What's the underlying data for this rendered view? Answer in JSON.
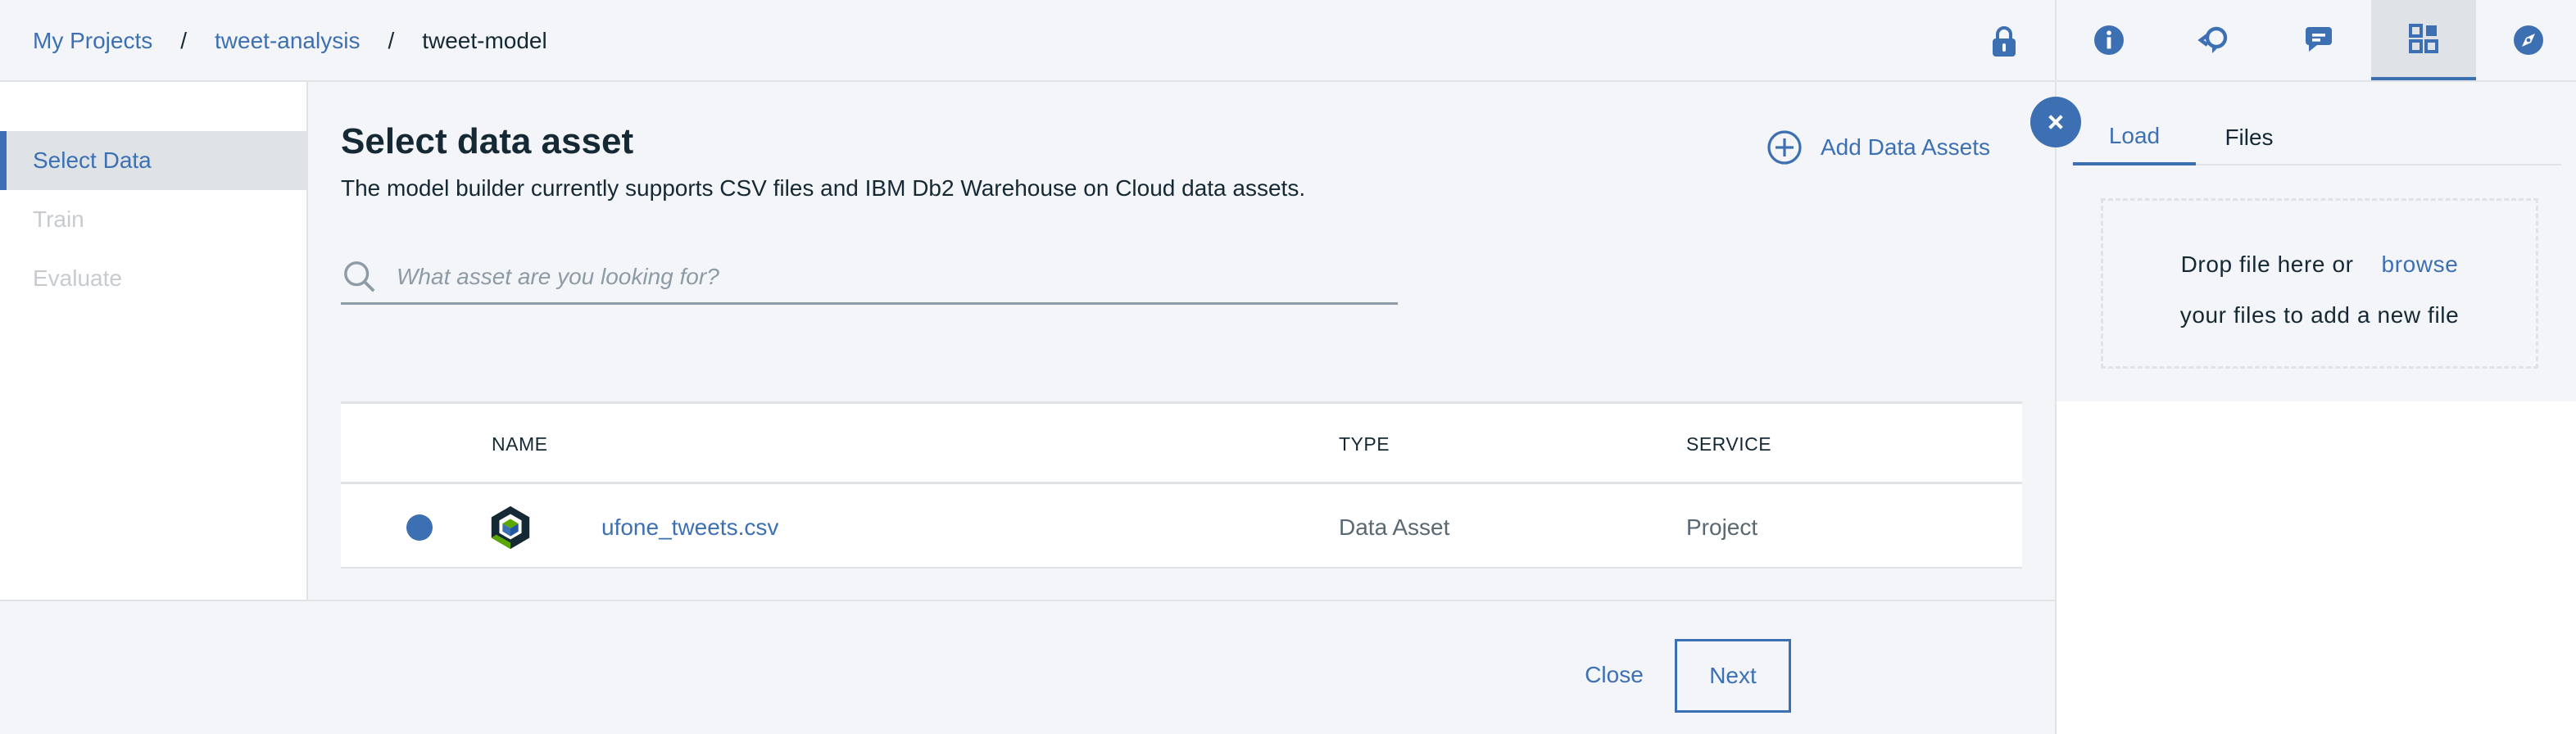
{
  "breadcrumb": {
    "items": [
      "My Projects",
      "tweet-analysis"
    ],
    "separator": "/",
    "current": "tweet-model"
  },
  "toolbar": {
    "icons": [
      "info-icon",
      "feedback-icon",
      "chat-icon",
      "data-assets-icon",
      "compass-icon"
    ],
    "active": "data-assets-icon"
  },
  "leftnav": {
    "items": [
      {
        "label": "Select Data",
        "active": true
      },
      {
        "label": "Train",
        "active": false
      },
      {
        "label": "Evaluate",
        "active": false
      }
    ]
  },
  "main": {
    "title": "Select data asset",
    "description": "The model builder currently supports CSV files and IBM Db2 Warehouse on Cloud data assets.",
    "add_assets_label": "Add Data Assets",
    "search_placeholder": "What asset are you looking for?"
  },
  "table": {
    "columns": [
      "NAME",
      "TYPE",
      "SERVICE"
    ],
    "rows": [
      {
        "name": "ufone_tweets.csv",
        "type": "Data Asset",
        "service": "Project",
        "selected": true
      }
    ]
  },
  "footer": {
    "close_label": "Close",
    "next_label": "Next"
  },
  "panel": {
    "tabs": [
      "Load",
      "Files"
    ],
    "active_tab": "Load",
    "dropzone_prefix": "Drop file here or",
    "dropzone_link": "browse",
    "dropzone_suffix": "your files to add a new file"
  },
  "colors": {
    "accent": "#3d70b2",
    "text": "#152935",
    "muted": "#5a6872",
    "disabled": "#c7cbcf",
    "border": "#dfe3e6",
    "background": "#f4f5f9"
  }
}
